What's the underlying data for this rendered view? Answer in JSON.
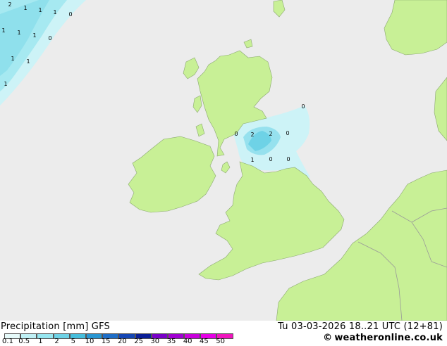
{
  "map": {
    "sea_color": "#ececec",
    "land_color": "#c8f096",
    "border_color": "#999999",
    "precip_labels": [
      "2",
      "1",
      "1",
      "1",
      "0",
      "1",
      "1",
      "1",
      "0",
      "1",
      "1",
      "1",
      "0",
      "0",
      "2",
      "2",
      "0",
      "1",
      "0",
      "0"
    ]
  },
  "footer": {
    "title_left": "Precipitation [mm]  GFS",
    "title_right": "Tu 03-03-2026 18..21 UTC (12+81)",
    "credit_symbol": "©",
    "credit": "weatheronline.co.uk",
    "legend_ticks": [
      "0.1",
      "0.5",
      "1",
      "2",
      "5",
      "10",
      "15",
      "20",
      "25",
      "30",
      "35",
      "40",
      "45",
      "50"
    ],
    "legend_colors": [
      "#e6fafa",
      "#bff0f5",
      "#96e6f0",
      "#6ed2e6",
      "#46bedc",
      "#2896d2",
      "#1e6ec8",
      "#1446b4",
      "#0a1e96",
      "#7800c8",
      "#a000d2",
      "#c800dc",
      "#e600e6",
      "#f014be"
    ]
  }
}
